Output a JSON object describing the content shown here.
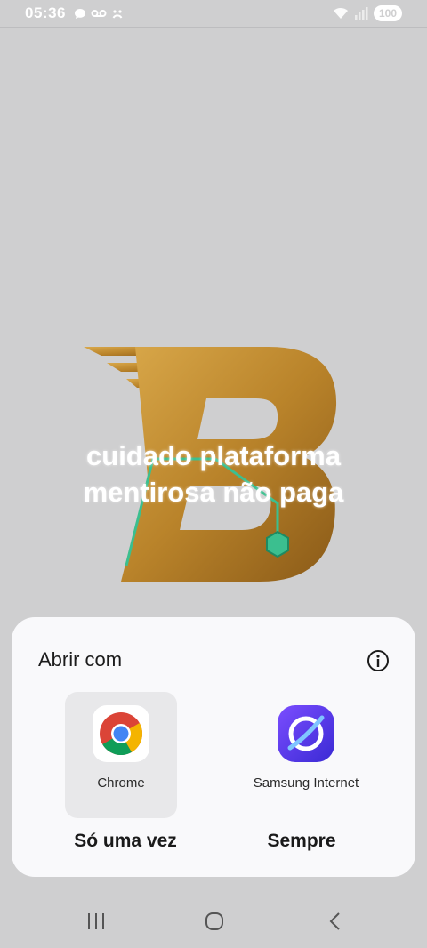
{
  "status": {
    "time": "05:36",
    "battery": "100",
    "left_icons": [
      "chat-bubble-icon",
      "voicemail-icon",
      "sad-face-icon"
    ],
    "right_icons": [
      "wifi-icon",
      "signal-icon"
    ]
  },
  "overlay": {
    "line1": "cuidado plataforma",
    "line2": "mentirosa não paga"
  },
  "sheet": {
    "title": "Abrir com",
    "info_icon": "info-icon",
    "apps": [
      {
        "label": "Chrome",
        "icon": "chrome-icon",
        "selected": true
      },
      {
        "label": "Samsung Internet",
        "icon": "samsung-internet-icon",
        "selected": false
      }
    ],
    "once_label": "Só uma vez",
    "always_label": "Sempre"
  },
  "nav": {
    "icons": [
      "recents-icon",
      "home-icon",
      "back-icon"
    ]
  },
  "colors": {
    "background": "#cfcfd0",
    "sheet": "#f9f9fb",
    "logo_gold": "#c08a2a",
    "logo_accent": "#3bbf8f"
  }
}
